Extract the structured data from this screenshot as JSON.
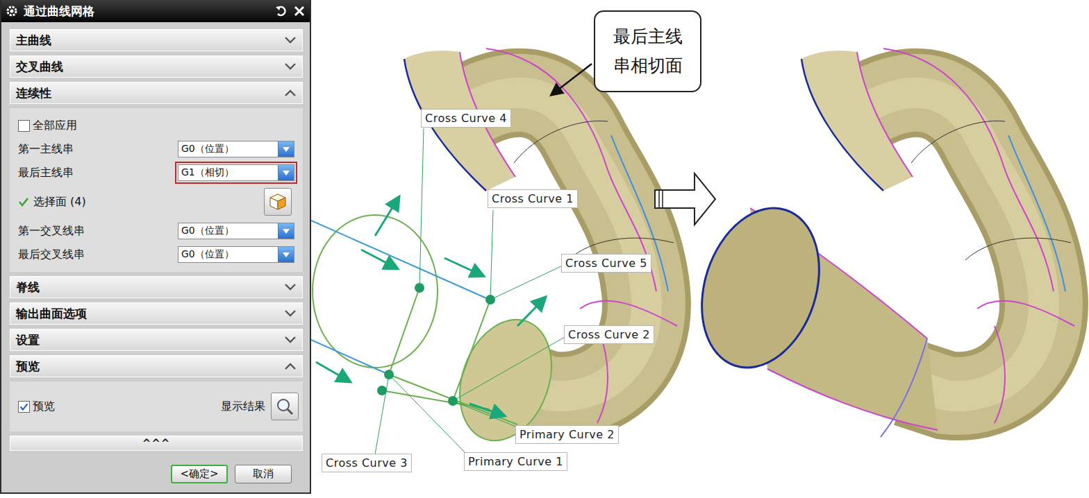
{
  "dialog": {
    "title": "通过曲线网格",
    "sections": [
      {
        "label": "主曲线",
        "expanded": false,
        "kind": "plain"
      },
      {
        "label": "交叉曲线",
        "expanded": false,
        "kind": "plain"
      },
      {
        "label": "连续性",
        "expanded": true,
        "kind": "continuity"
      },
      {
        "label": "脊线",
        "expanded": false,
        "kind": "plain"
      },
      {
        "label": "输出曲面选项",
        "expanded": false,
        "kind": "plain"
      },
      {
        "label": "设置",
        "expanded": false,
        "kind": "plain"
      },
      {
        "label": "预览",
        "expanded": true,
        "kind": "preview"
      }
    ],
    "apply_all": {
      "label": "全部应用",
      "checked": false
    },
    "rows": [
      {
        "kind": "select",
        "label": "第一主线串",
        "value": "G0（位置）",
        "highlighted": false
      },
      {
        "kind": "select",
        "label": "最后主线串",
        "value": "G1（相切）",
        "highlighted": true
      },
      {
        "kind": "face",
        "label": "选择面 (4)",
        "done": true
      },
      {
        "kind": "select",
        "label": "第一交叉线串",
        "value": "G0（位置）",
        "highlighted": false
      },
      {
        "kind": "select",
        "label": "最后交叉线串",
        "value": "G0（位置）",
        "highlighted": false
      }
    ],
    "preview": {
      "label": "预览",
      "checked": true,
      "show_result": "显示结果"
    },
    "more": "^^^",
    "buttons": [
      {
        "label": "<确定>",
        "default": true
      },
      {
        "label": "取消",
        "default": false
      }
    ]
  },
  "viewport": {
    "labels": [
      "Cross Curve 4",
      "Cross Curve 1",
      "Cross Curve 5",
      "Cross Curve 2",
      "Primary Curve 2",
      "Primary Curve 1",
      "Cross Curve 3"
    ],
    "callout": "最后主线串相切面"
  }
}
